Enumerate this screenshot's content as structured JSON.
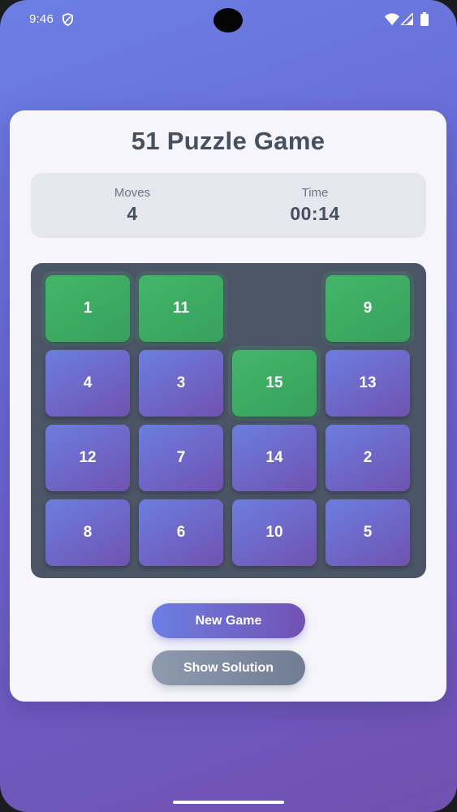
{
  "status_bar": {
    "time": "9:46",
    "icons": [
      "shield-icon",
      "wifi-icon",
      "signal-icon",
      "battery-icon"
    ]
  },
  "app": {
    "title": "51 Puzzle Game"
  },
  "stats": {
    "moves_label": "Moves",
    "moves_value": "4",
    "time_label": "Time",
    "time_value": "00:14"
  },
  "board": {
    "size": 4,
    "tiles": [
      {
        "label": "1",
        "state": "correct"
      },
      {
        "label": "11",
        "state": "correct"
      },
      {
        "label": "",
        "state": "empty"
      },
      {
        "label": "9",
        "state": "correct"
      },
      {
        "label": "4",
        "state": "normal"
      },
      {
        "label": "3",
        "state": "normal"
      },
      {
        "label": "15",
        "state": "correct"
      },
      {
        "label": "13",
        "state": "normal"
      },
      {
        "label": "12",
        "state": "normal"
      },
      {
        "label": "7",
        "state": "normal"
      },
      {
        "label": "14",
        "state": "normal"
      },
      {
        "label": "2",
        "state": "normal"
      },
      {
        "label": "8",
        "state": "normal"
      },
      {
        "label": "6",
        "state": "normal"
      },
      {
        "label": "10",
        "state": "normal"
      },
      {
        "label": "5",
        "state": "normal"
      }
    ]
  },
  "buttons": {
    "new_game": "New Game",
    "show_solution": "Show Solution"
  },
  "colors": {
    "background_start": "#6b7fe3",
    "background_end": "#7150b0",
    "tile_correct": "#43b66a",
    "tile_normal_start": "#6b7ee0",
    "tile_normal_end": "#7052b0",
    "board": "#4b5566",
    "title_text": "#46505f"
  }
}
